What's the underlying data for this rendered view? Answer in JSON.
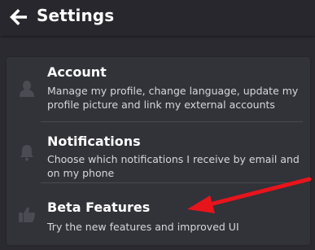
{
  "header": {
    "title": "Settings",
    "back_icon": "arrow-left-icon"
  },
  "items": [
    {
      "title": "Account",
      "description": "Manage my profile, change language, update my profile picture and link my external accounts",
      "icon": "user-icon"
    },
    {
      "title": "Notifications",
      "description": "Choose which notifications I receive by email and on my phone",
      "icon": "bell-icon"
    },
    {
      "title": "Beta Features",
      "description": "Try the new features and improved UI",
      "icon": "thumbs-up-icon"
    }
  ],
  "colors": {
    "background": "#2a2a30",
    "card": "#323239",
    "annotation_arrow": "#e8141c"
  }
}
